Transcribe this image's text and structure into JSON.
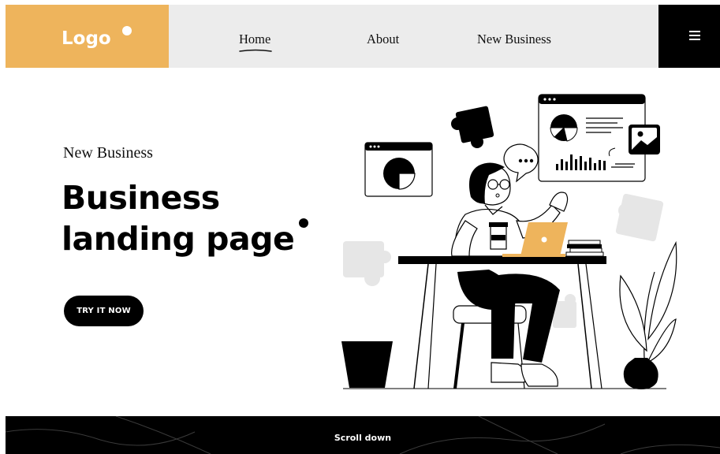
{
  "header": {
    "logo": "Logo",
    "nav": [
      {
        "label": "Home",
        "active": true
      },
      {
        "label": "About"
      },
      {
        "label": "New Business"
      }
    ],
    "menu_icon": "hamburger-menu-icon"
  },
  "hero": {
    "subtitle": "New Business",
    "title_line1": "Business",
    "title_line2": "landing page",
    "cta_label": "TRY IT NOW"
  },
  "footer": {
    "scroll_label": "Scroll down"
  },
  "colors": {
    "accent": "#eeb45c",
    "nav_bg": "#ececec",
    "dark": "#000000",
    "puzzle_gray": "#e6e6e6"
  }
}
